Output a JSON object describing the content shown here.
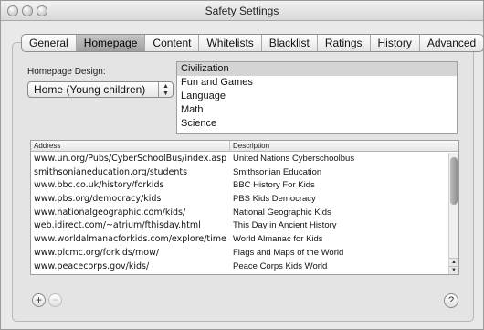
{
  "window": {
    "title": "Safety Settings"
  },
  "tabs": [
    {
      "label": "General"
    },
    {
      "label": "Homepage",
      "active": true
    },
    {
      "label": "Content"
    },
    {
      "label": "Whitelists"
    },
    {
      "label": "Blacklist"
    },
    {
      "label": "Ratings"
    },
    {
      "label": "History"
    },
    {
      "label": "Advanced"
    }
  ],
  "homepage_design": {
    "label": "Homepage Design:",
    "selected": "Home (Young children)"
  },
  "categories": {
    "items": [
      "Civilization",
      "Fun and Games",
      "Language",
      "Math",
      "Science"
    ],
    "selected": "Civilization"
  },
  "table": {
    "headers": {
      "address": "Address",
      "description": "Description"
    },
    "rows": [
      {
        "address": "www.un.org/Pubs/CyberSchoolBus/index.asp",
        "description": "United Nations Cyberschoolbus"
      },
      {
        "address": "smithsonianeducation.org/students",
        "description": "Smithsonian Education"
      },
      {
        "address": "www.bbc.co.uk/history/forkids",
        "description": "BBC History For Kids"
      },
      {
        "address": "www.pbs.org/democracy/kids",
        "description": "PBS Kids Democracy"
      },
      {
        "address": "www.nationalgeographic.com/kids/",
        "description": "National Geographic Kids"
      },
      {
        "address": "web.idirect.com/~atrium/fthisday.html",
        "description": "This Day in Ancient History"
      },
      {
        "address": "www.worldalmanacforkids.com/explore/time",
        "description": "World Almanac for Kids"
      },
      {
        "address": "www.plcmc.org/forkids/mow/",
        "description": "Flags and Maps of the World"
      },
      {
        "address": "www.peacecorps.gov/kids/",
        "description": "Peace Corps Kids World"
      }
    ]
  },
  "buttons": {
    "add": "+",
    "remove": "−",
    "help": "?"
  },
  "icons": {
    "popup_arrows": "⇅",
    "scroll_up": "▲",
    "scroll_down": "▼"
  }
}
